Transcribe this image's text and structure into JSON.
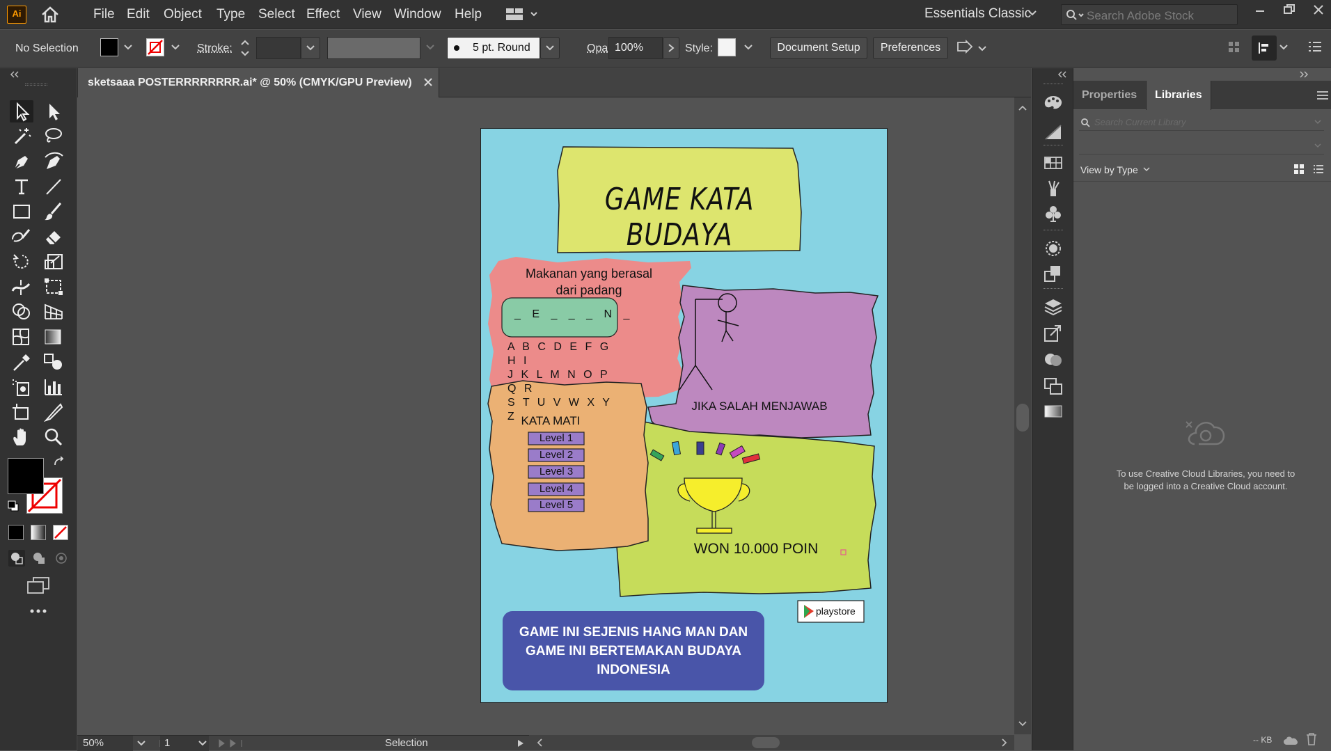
{
  "app": {
    "logo": "Ai"
  },
  "menu": [
    "File",
    "Edit",
    "Object",
    "Type",
    "Select",
    "Effect",
    "View",
    "Window",
    "Help"
  ],
  "workspace": "Essentials Classic",
  "search": {
    "placeholder": "Search Adobe Stock"
  },
  "control": {
    "selection": "No Selection",
    "stroke_label": "Stroke:",
    "brush": "5 pt. Round",
    "opacity_label": "Opacity:",
    "opacity_value": "100%",
    "style_label": "Style:",
    "document_setup": "Document Setup",
    "preferences": "Preferences"
  },
  "document": {
    "tab_title": "sketsaaa POSTERRRRRRRR.ai* @ 50% (CMYK/GPU Preview)"
  },
  "status": {
    "zoom": "50%",
    "artboard": "1",
    "tool": "Selection"
  },
  "right_panel": {
    "tabs": [
      "Properties",
      "Libraries"
    ],
    "active_tab": "Libraries",
    "search_placeholder": "Search Current Library",
    "view_by": "View by Type",
    "message": "To use Creative Cloud Libraries, you need to be logged into a Creative Cloud account.",
    "size": "-- KB"
  },
  "poster": {
    "title": "GAME KATA BUDAYA",
    "question_line1": "Makanan yang berasal",
    "question_line2": "dari padang",
    "blanks": "_ E _ _ _ N _",
    "letters": [
      "A B C D E F G H I",
      "J K L M N O P Q R",
      "S T U V W X Y Z"
    ],
    "wrong_caption": "JIKA SALAH MENJAWAB",
    "kata_mati": "KATA MATI",
    "levels": [
      "Level 1",
      "Level 2",
      "Level 3",
      "Level 4",
      "Level 5"
    ],
    "won": "WON 10.000 POIN",
    "playstore": "playstore",
    "footer_line1": "GAME INI SEJENIS HANG MAN DAN",
    "footer_line2": "GAME INI BERTEMAKAN BUDAYA",
    "footer_line3": "INDONESIA"
  },
  "colors": {
    "artboard_bg": "#87d3e3",
    "title_card": "#dde56e",
    "question_card": "#ec8b8a",
    "hangman_card": "#bd88bf",
    "kata_mati_card": "#ebb174",
    "trophy_card": "#c6dc5a",
    "footer": "#4955a9",
    "accent": "#ff9a00"
  }
}
